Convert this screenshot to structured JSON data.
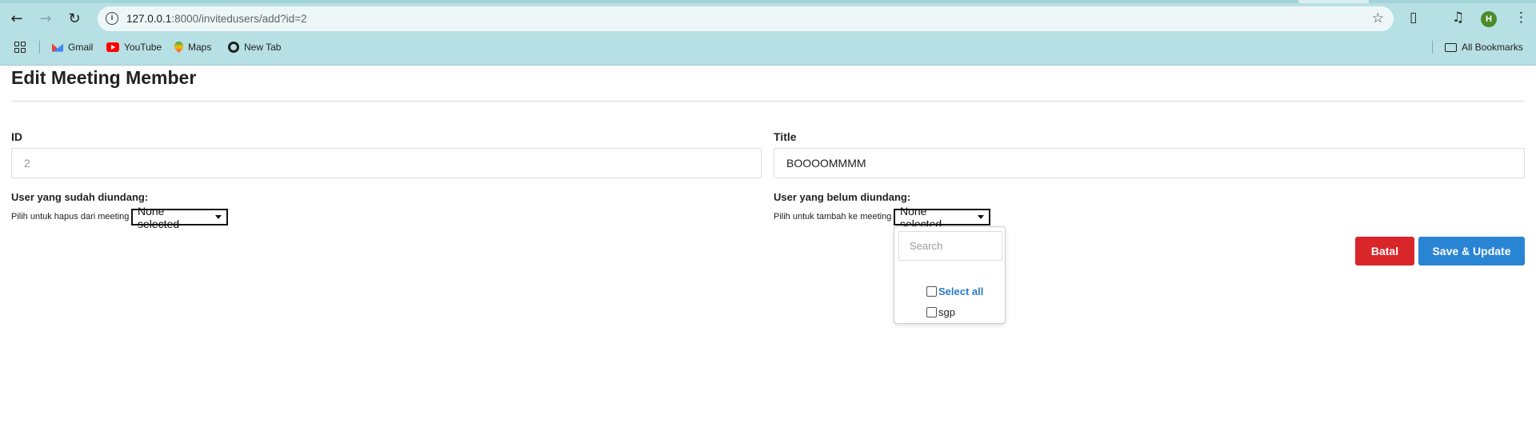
{
  "browser": {
    "url_host": "127.0.0.1",
    "url_rest": ":8000/invitedusers/add?id=2",
    "avatar_letter": "H",
    "bookmarks": [
      "Gmail",
      "YouTube",
      "Maps",
      "New Tab"
    ],
    "all_bookmarks": "All Bookmarks"
  },
  "page": {
    "title": "Edit Meeting Member"
  },
  "form": {
    "id_label": "ID",
    "id_value": "2",
    "title_label": "Title",
    "title_value": "BOOOOMMMM",
    "invited_label": "User yang sudah diundang:",
    "invited_helper": "Pilih untuk hapus dari meeting",
    "invited_select": "None selected",
    "uninvited_label": "User yang belum diundang:",
    "uninvited_helper": "Pilih untuk tambah ke meeting",
    "uninvited_select": "None selected"
  },
  "dropdown": {
    "search_placeholder": "Search",
    "select_all": "Select all",
    "options": [
      "sgp"
    ]
  },
  "buttons": {
    "cancel": "Batal",
    "save": "Save & Update"
  },
  "colors": {
    "chrome": "#b7e0e4",
    "cancel": "#d9262b",
    "save": "#2a84d4",
    "link": "#2a7bc6"
  }
}
